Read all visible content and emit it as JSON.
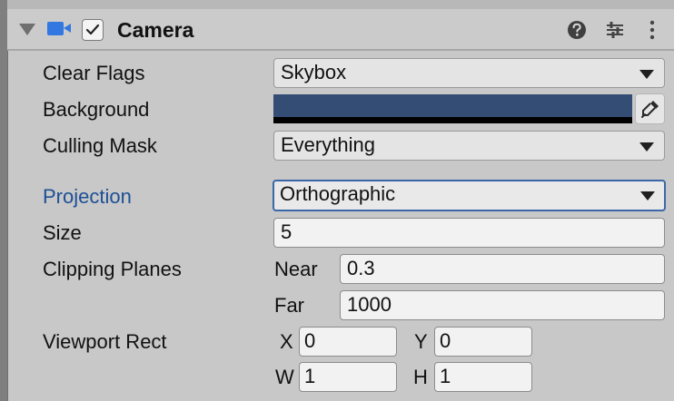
{
  "component": {
    "title": "Camera",
    "enabled": true,
    "icons": {
      "component_icon": "camera-icon",
      "help": "help-icon",
      "presets": "preset-sliders-icon",
      "menu": "more-vertical-icon",
      "foldout": "triangle-down-icon"
    },
    "accent_color": "#3377e0"
  },
  "properties": {
    "clear_flags": {
      "label": "Clear Flags",
      "value": "Skybox"
    },
    "background": {
      "label": "Background",
      "color": "#344d75",
      "alpha_bar_color": "#000000",
      "picker_icon": "eyedropper-icon"
    },
    "culling_mask": {
      "label": "Culling Mask",
      "value": "Everything"
    },
    "projection": {
      "label": "Projection",
      "value": "Orthographic",
      "highlight_color": "#1d4f96"
    },
    "size": {
      "label": "Size",
      "value": "5"
    },
    "clipping_planes": {
      "label": "Clipping Planes",
      "near_label": "Near",
      "near_value": "0.3",
      "far_label": "Far",
      "far_value": "1000"
    },
    "viewport_rect": {
      "label": "Viewport Rect",
      "x_label": "X",
      "x_value": "0",
      "y_label": "Y",
      "y_value": "0",
      "w_label": "W",
      "w_value": "1",
      "h_label": "H",
      "h_value": "1"
    }
  }
}
